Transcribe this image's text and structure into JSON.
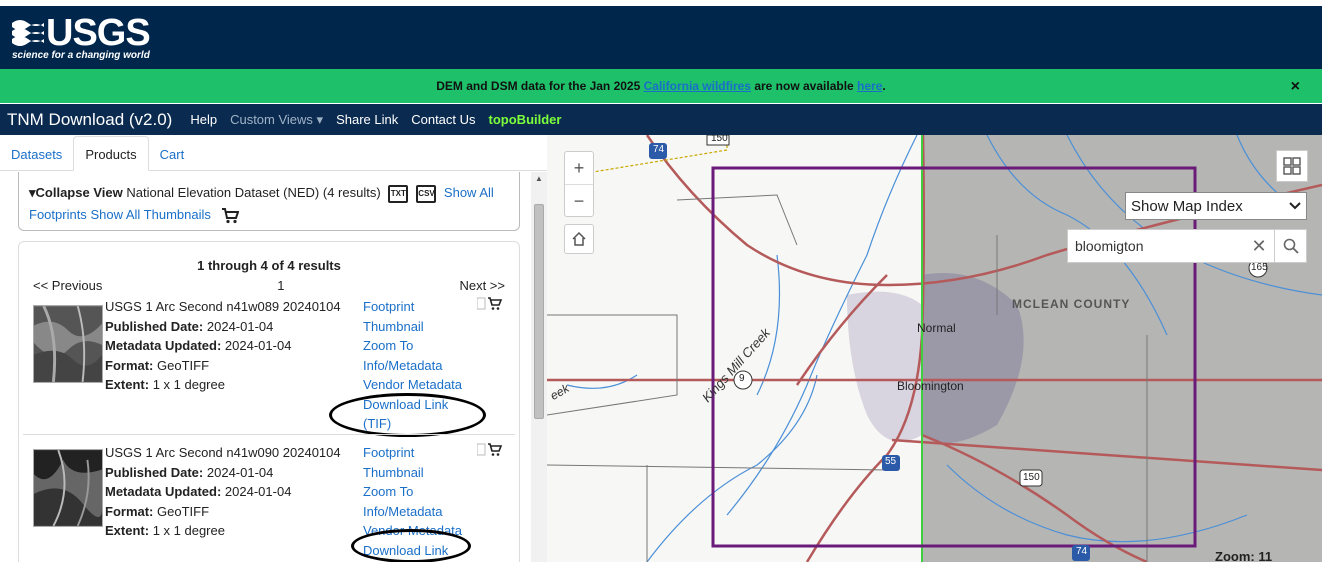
{
  "header": {
    "logo": "USGS",
    "tagline": "science for a changing world"
  },
  "banner": {
    "text_before": "DEM and DSM data for the Jan 2025 ",
    "link1": "California wildfires",
    "text_middle": " are now available ",
    "link2": "here",
    "text_after": ".",
    "close": "×"
  },
  "navbar": {
    "brand": "TNM Download (v2.0)",
    "items": [
      "Help",
      "Custom Views ▾",
      "Share Link",
      "Contact Us",
      "topoBuilder"
    ]
  },
  "tabs": [
    "Datasets",
    "Products",
    "Cart"
  ],
  "collapse": {
    "toggle": "▾Collapse View",
    "dataset": "National Elevation Dataset (NED) (4 results)",
    "txt": "TXT",
    "csv": "CSV",
    "show_all_footprints": "Show All Footprints",
    "show_all_thumbnails": "Show All Thumbnails"
  },
  "results": {
    "title": "1 through 4 of 4 results",
    "previous": "<< Previous",
    "page": "1",
    "next": "Next >>",
    "items": [
      {
        "name": "USGS 1 Arc Second n41w089 20240104",
        "published_label": "Published Date:",
        "published": "2024-01-04",
        "updated_label": "Metadata Updated:",
        "updated": "2024-01-04",
        "format_label": "Format:",
        "format": "GeoTIFF",
        "extent_label": "Extent:",
        "extent": "1 x 1 degree",
        "links": [
          "Footprint",
          "Thumbnail",
          "Zoom To",
          "Info/Metadata",
          "Vendor Metadata",
          "Download Link",
          "(TIF)"
        ]
      },
      {
        "name": "USGS 1 Arc Second n41w090 20240104",
        "published_label": "Published Date:",
        "published": "2024-01-04",
        "updated_label": "Metadata Updated:",
        "updated": "2024-01-04",
        "format_label": "Format:",
        "format": "GeoTIFF",
        "extent_label": "Extent:",
        "extent": "1 x 1 degree",
        "links": [
          "Footprint",
          "Thumbnail",
          "Zoom To",
          "Info/Metadata",
          "Vendor Metadata",
          "Download Link"
        ]
      }
    ]
  },
  "map": {
    "zoom_in": "+",
    "zoom_out": "−",
    "map_index": "Show Map Index",
    "search_value": "bloomigton",
    "county": "MCLEAN COUNTY",
    "normal": "Normal",
    "bloomington": "Bloomington",
    "creek": "Kings Mill Creek",
    "route9": "9",
    "i55": "55",
    "i74_top": "74",
    "i74_bottom": "74",
    "us150_top": "150",
    "us150_bottom": "150",
    "r165": "165",
    "eek": "eek",
    "zoom": "Zoom: 11",
    "colors": {
      "footprint": "#6a1b7a",
      "boundary": "#3ecf3e",
      "roads": "#b55a5a",
      "water": "#4a8fd8"
    }
  }
}
